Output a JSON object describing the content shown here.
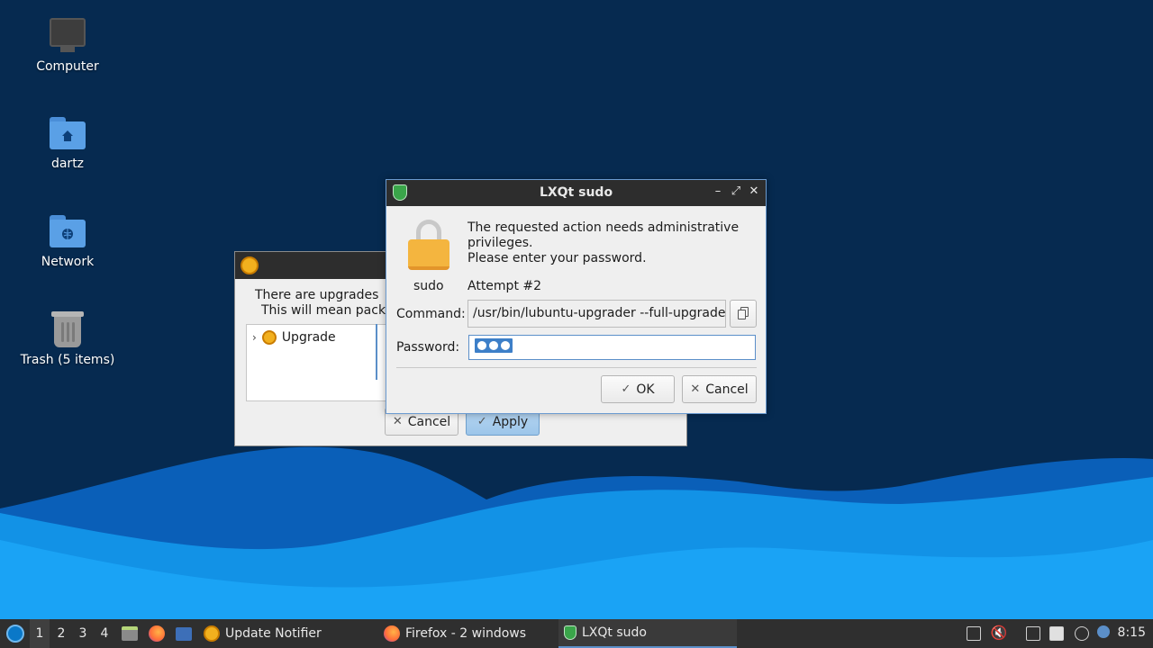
{
  "desktop": {
    "icons": [
      {
        "label": "Computer",
        "icon": "computer-icon"
      },
      {
        "label": "dartz",
        "icon": "home-folder-icon"
      },
      {
        "label": "Network",
        "icon": "network-folder-icon"
      },
      {
        "label": "Trash (5 items)",
        "icon": "trash-icon"
      }
    ]
  },
  "update_notifier": {
    "message_line1": "There are upgrades",
    "message_line2": "This will mean pack",
    "tree_item": "Upgrade",
    "cancel_label": "Cancel",
    "apply_label": "Apply"
  },
  "sudo_dialog": {
    "title": "LXQt sudo",
    "message_line1": "The requested action needs administrative",
    "message_line2": "privileges.",
    "message_line3": "Please enter your password.",
    "user_label": "sudo",
    "attempt": "Attempt #2",
    "command_label": "Command:",
    "command_value": "/usr/bin/lubuntu-upgrader --full-upgrade",
    "password_label": "Password:",
    "password_masked_count": 3,
    "ok_label": "OK",
    "cancel_label": "Cancel",
    "title_controls": [
      "minimize-icon",
      "maximize-icon",
      "close-icon"
    ]
  },
  "taskbar": {
    "workspaces": [
      "1",
      "2",
      "3",
      "4"
    ],
    "active_workspace": "1",
    "tasks": [
      {
        "label": "Update Notifier",
        "icon": "update-icon"
      },
      {
        "label": "Firefox - 2 windows",
        "icon": "firefox-icon"
      },
      {
        "label": "LXQt sudo",
        "icon": "shield-icon"
      }
    ],
    "clock": "8:15"
  },
  "colors": {
    "desktop_bg": "#062a50",
    "wave_light": "#1aa3f5",
    "wave_mid": "#0a7ad6",
    "accent": "#5b8fc9",
    "titlebar": "#2d2d2d"
  }
}
